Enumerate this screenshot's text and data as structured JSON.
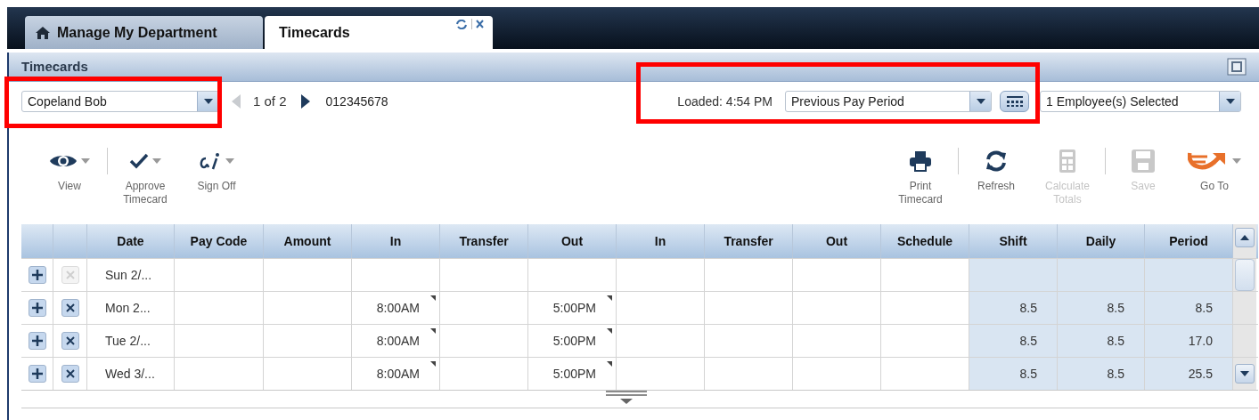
{
  "tabs": [
    {
      "label": "Manage My Department",
      "selected": false
    },
    {
      "label": "Timecards",
      "selected": true
    }
  ],
  "panel": {
    "title": "Timecards"
  },
  "employee_select": {
    "value": "Copeland Bob"
  },
  "pager": {
    "text": "1 of 2",
    "prev_disabled": true,
    "next_disabled": false
  },
  "employee_id": "012345678",
  "loaded": "Loaded: 4:54 PM",
  "period_select": {
    "value": "Previous Pay Period"
  },
  "selection_select": {
    "value": "1 Employee(s) Selected"
  },
  "toolbar": [
    {
      "label": "View",
      "menu": true,
      "disabled": false
    },
    {
      "label": "Approve\nTimecard",
      "menu": true,
      "disabled": false
    },
    {
      "label": "Sign Off",
      "menu": true,
      "disabled": false
    },
    {
      "label": "Print\nTimecard",
      "menu": false,
      "disabled": false
    },
    {
      "label": "Refresh",
      "menu": false,
      "disabled": false
    },
    {
      "label": "Calculate\nTotals",
      "menu": false,
      "disabled": true
    },
    {
      "label": "Save",
      "menu": false,
      "disabled": true
    },
    {
      "label": "Go To",
      "menu": true,
      "disabled": false
    }
  ],
  "table": {
    "columns": [
      "Date",
      "Pay Code",
      "Amount",
      "In",
      "Transfer",
      "Out",
      "In",
      "Transfer",
      "Out",
      "Schedule",
      "Shift",
      "Daily",
      "Period"
    ],
    "rows": [
      {
        "delete_disabled": true,
        "cells": [
          "Sun 2/...",
          "",
          "",
          "",
          "",
          "",
          "",
          "",
          "",
          "",
          "",
          "",
          ""
        ]
      },
      {
        "delete_disabled": false,
        "cells": [
          "Mon 2...",
          "",
          "",
          "8:00AM",
          "",
          "5:00PM",
          "",
          "",
          "",
          "",
          "8.5",
          "8.5",
          "8.5"
        ]
      },
      {
        "delete_disabled": false,
        "cells": [
          "Tue 2/...",
          "",
          "",
          "8:00AM",
          "",
          "5:00PM",
          "",
          "",
          "",
          "",
          "8.5",
          "8.5",
          "17.0"
        ]
      },
      {
        "delete_disabled": false,
        "cells": [
          "Wed 3/...",
          "",
          "",
          "8:00AM",
          "",
          "5:00PM",
          "",
          "",
          "",
          "",
          "8.5",
          "8.5",
          "25.5"
        ]
      }
    ]
  }
}
